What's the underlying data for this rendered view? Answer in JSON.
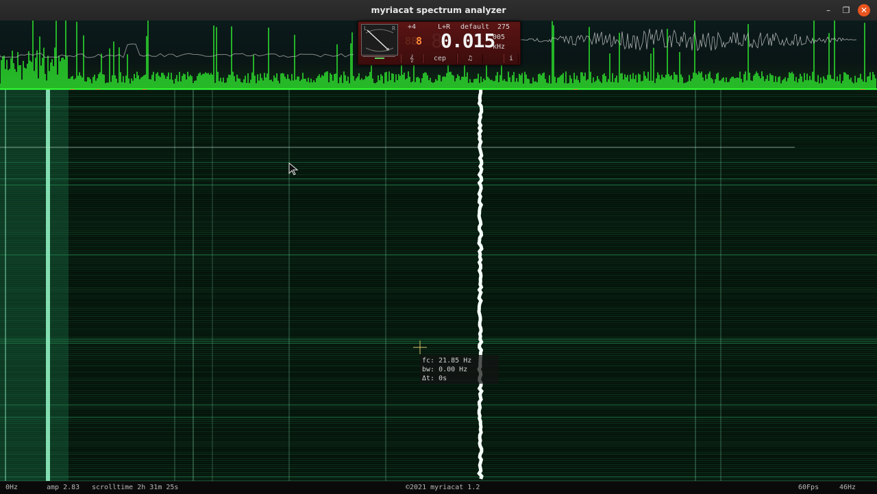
{
  "window": {
    "title": "myriacat spectrum analyzer",
    "buttons": {
      "minimize": "–",
      "maximize": "❐",
      "close": "✕"
    }
  },
  "panel": {
    "meter_left": "L",
    "meter_right": "R",
    "gain": "+4",
    "channel": "L+R",
    "preset": "default",
    "counter": "275",
    "small_digits_dim": "88",
    "small_digit": "8",
    "freq_dim": "8",
    "frequency": "0.015",
    "freq_sub": "005",
    "unit": "kHz",
    "buttons": [
      {
        "label": "𝄞",
        "name": "clef-button"
      },
      {
        "label": "cep",
        "name": "cep-button"
      },
      {
        "label": "♫",
        "name": "notes-button"
      },
      {
        "label": "i",
        "name": "info-button"
      }
    ],
    "accent": "#4a0f0f"
  },
  "cursor_readout": {
    "fc": "fc: 21.85 Hz",
    "bw": "bw: 0.00 Hz",
    "dt": "Δt: 0s"
  },
  "status": {
    "min_freq": "0Hz",
    "amp": "amp 2.83",
    "scrolltime": "scrolltime 2h 31m 25s",
    "copyright": "©2021 myriacat 1.2",
    "fps": "60Fps",
    "max_freq": "46Hz"
  },
  "colors": {
    "spectrum": "#33ff33",
    "waterfall_bg": "#041008",
    "close_button": "#e9541f"
  }
}
